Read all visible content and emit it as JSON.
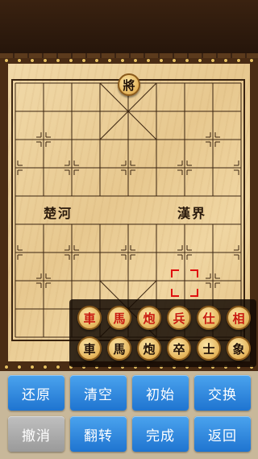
{
  "board": {
    "river_left": "楚河",
    "river_right": "漢界"
  },
  "board_pieces": [
    {
      "label": "將",
      "side": "black"
    }
  ],
  "tray": {
    "red_row": [
      "車",
      "馬",
      "炮",
      "兵",
      "仕",
      "相"
    ],
    "black_row": [
      "車",
      "馬",
      "炮",
      "卒",
      "士",
      "象"
    ]
  },
  "buttons": [
    {
      "label": "还原",
      "enabled": true
    },
    {
      "label": "清空",
      "enabled": true
    },
    {
      "label": "初始",
      "enabled": true
    },
    {
      "label": "交换",
      "enabled": true
    },
    {
      "label": "撤消",
      "enabled": false
    },
    {
      "label": "翻转",
      "enabled": true
    },
    {
      "label": "完成",
      "enabled": true
    },
    {
      "label": "返回",
      "enabled": true
    }
  ],
  "colors": {
    "button_blue": "#2a86de",
    "red_piece_text": "#c81a10",
    "selection_marker": "#e01010"
  }
}
